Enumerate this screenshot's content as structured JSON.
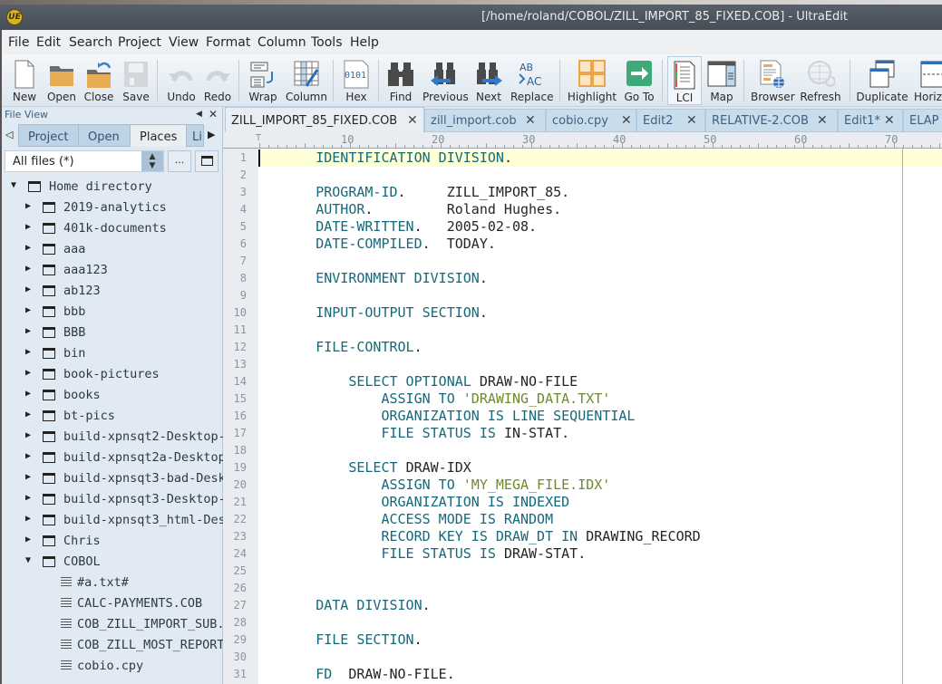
{
  "window": {
    "title": "[/home/roland/COBOL/ZILL_IMPORT_85_FIXED.COB] - UltraEdit",
    "logo": "UE"
  },
  "menu": [
    "File",
    "Edit",
    "Search",
    "Project",
    "View",
    "Format",
    "Column",
    "Tools",
    "Help"
  ],
  "toolbar": [
    {
      "label": "New",
      "icon": "new-file-icon"
    },
    {
      "label": "Open",
      "icon": "open-folder-icon"
    },
    {
      "label": "Close",
      "icon": "close-folder-icon"
    },
    {
      "label": "Save",
      "icon": "save-icon",
      "disabled": true
    },
    {
      "label": "Undo",
      "icon": "undo-icon",
      "disabled": true
    },
    {
      "label": "Redo",
      "icon": "redo-icon",
      "disabled": true
    },
    {
      "label": "Wrap",
      "icon": "wrap-icon"
    },
    {
      "label": "Column",
      "icon": "column-mode-icon"
    },
    {
      "label": "Hex",
      "icon": "hex-icon"
    },
    {
      "label": "Find",
      "icon": "binoculars-icon"
    },
    {
      "label": "Previous",
      "icon": "find-previous-icon"
    },
    {
      "label": "Next",
      "icon": "find-next-icon"
    },
    {
      "label": "Replace",
      "icon": "replace-icon"
    },
    {
      "label": "Highlight",
      "icon": "highlight-icon"
    },
    {
      "label": "Go To",
      "icon": "goto-icon"
    },
    {
      "label": "LCI",
      "icon": "lci-icon",
      "active": true
    },
    {
      "label": "Map",
      "icon": "map-icon"
    },
    {
      "label": "Browser",
      "icon": "browser-icon"
    },
    {
      "label": "Refresh",
      "icon": "refresh-icon",
      "disabled": true
    },
    {
      "label": "Duplicate",
      "icon": "duplicate-window-icon"
    },
    {
      "label": "Horizontal",
      "icon": "horizontal-split-icon"
    }
  ],
  "file_view": {
    "header": "File View",
    "tabs": [
      "Project",
      "Open",
      "Places",
      "Li"
    ],
    "selected_tab": "Places",
    "filter": "All files (*)",
    "browse_label": "...",
    "tree": [
      {
        "name": "Home directory",
        "type": "folder",
        "depth": 0,
        "expanded": true
      },
      {
        "name": "2019-analytics",
        "type": "folder",
        "depth": 1
      },
      {
        "name": "401k-documents",
        "type": "folder",
        "depth": 1
      },
      {
        "name": "aaa",
        "type": "folder",
        "depth": 1
      },
      {
        "name": "aaa123",
        "type": "folder",
        "depth": 1
      },
      {
        "name": "ab123",
        "type": "folder",
        "depth": 1
      },
      {
        "name": "bbb",
        "type": "folder",
        "depth": 1
      },
      {
        "name": "BBB",
        "type": "folder",
        "depth": 1
      },
      {
        "name": "bin",
        "type": "folder",
        "depth": 1
      },
      {
        "name": "book-pictures",
        "type": "folder",
        "depth": 1
      },
      {
        "name": "books",
        "type": "folder",
        "depth": 1
      },
      {
        "name": "bt-pics",
        "type": "folder",
        "depth": 1
      },
      {
        "name": "build-xpnsqt2-Desktop-",
        "type": "folder",
        "depth": 1
      },
      {
        "name": "build-xpnsqt2a-Desktop",
        "type": "folder",
        "depth": 1
      },
      {
        "name": "build-xpnsqt3-bad-Desk",
        "type": "folder",
        "depth": 1
      },
      {
        "name": "build-xpnsqt3-Desktop-",
        "type": "folder",
        "depth": 1
      },
      {
        "name": "build-xpnsqt3_html-Des",
        "type": "folder",
        "depth": 1
      },
      {
        "name": "Chris",
        "type": "folder",
        "depth": 1
      },
      {
        "name": "COBOL",
        "type": "folder",
        "depth": 1,
        "expanded": true
      },
      {
        "name": "#a.txt#",
        "type": "file",
        "depth": 2
      },
      {
        "name": "CALC-PAYMENTS.COB",
        "type": "file",
        "depth": 2
      },
      {
        "name": "COB_ZILL_IMPORT_SUB.",
        "type": "file",
        "depth": 2
      },
      {
        "name": "COB_ZILL_MOST_REPORT",
        "type": "file",
        "depth": 2
      },
      {
        "name": "cobio.cpy",
        "type": "file",
        "depth": 2
      }
    ]
  },
  "editor": {
    "tabs": [
      {
        "label": "ZILL_IMPORT_85_FIXED.COB",
        "selected": true
      },
      {
        "label": "zill_import.cob"
      },
      {
        "label": "cobio.cpy"
      },
      {
        "label": "Edit2"
      },
      {
        "label": "RELATIVE-2.COB"
      },
      {
        "label": "Edit1*"
      },
      {
        "label": "ELAP"
      }
    ],
    "ruler": [
      "10",
      "20",
      "30",
      "40",
      "50",
      "60",
      "70"
    ],
    "current_line": 1,
    "lines": [
      [
        [
          "kw",
          "       IDENTIFICATION DIVISION"
        ],
        [
          "id",
          "."
        ]
      ],
      [],
      [
        [
          "kw",
          "       PROGRAM-ID"
        ],
        [
          "id",
          ".     ZILL_IMPORT_85."
        ]
      ],
      [
        [
          "kw",
          "       AUTHOR"
        ],
        [
          "id",
          ".         Roland Hughes."
        ]
      ],
      [
        [
          "kw",
          "       DATE-WRITTEN"
        ],
        [
          "id",
          ".   2005-02-08."
        ]
      ],
      [
        [
          "kw",
          "       DATE-COMPILED"
        ],
        [
          "id",
          ".  TODAY."
        ]
      ],
      [],
      [
        [
          "kw",
          "       ENVIRONMENT DIVISION"
        ],
        [
          "id",
          "."
        ]
      ],
      [],
      [
        [
          "kw",
          "       INPUT-OUTPUT SECTION"
        ],
        [
          "id",
          "."
        ]
      ],
      [],
      [
        [
          "kw",
          "       FILE-CONTROL"
        ],
        [
          "id",
          "."
        ]
      ],
      [],
      [
        [
          "kw",
          "           SELECT OPTIONAL "
        ],
        [
          "id",
          "DRAW-NO-FILE"
        ]
      ],
      [
        [
          "kw",
          "               ASSIGN TO "
        ],
        [
          "str",
          "'DRAWING_DATA.TXT'"
        ]
      ],
      [
        [
          "kw",
          "               ORGANIZATION IS LINE SEQUENTIAL"
        ]
      ],
      [
        [
          "kw",
          "               FILE STATUS IS "
        ],
        [
          "id",
          "IN-STAT."
        ]
      ],
      [],
      [
        [
          "kw",
          "           SELECT "
        ],
        [
          "id",
          "DRAW-IDX"
        ]
      ],
      [
        [
          "kw",
          "               ASSIGN TO "
        ],
        [
          "str",
          "'MY_MEGA_FILE.IDX'"
        ]
      ],
      [
        [
          "kw",
          "               ORGANIZATION IS INDEXED"
        ]
      ],
      [
        [
          "kw",
          "               ACCESS MODE IS RANDOM"
        ]
      ],
      [
        [
          "kw",
          "               RECORD KEY IS DRAW_DT IN "
        ],
        [
          "id",
          "DRAWING_RECORD"
        ]
      ],
      [
        [
          "kw",
          "               FILE STATUS IS "
        ],
        [
          "id",
          "DRAW-STAT."
        ]
      ],
      [],
      [],
      [
        [
          "kw",
          "       DATA DIVISION"
        ],
        [
          "id",
          "."
        ]
      ],
      [],
      [
        [
          "kw",
          "       FILE SECTION"
        ],
        [
          "id",
          "."
        ]
      ],
      [],
      [
        [
          "kw",
          "       FD  "
        ],
        [
          "id",
          "DRAW-NO-FILE."
        ]
      ]
    ]
  },
  "colors": {
    "keyword": "#16697a",
    "string": "#6f8a2c",
    "identifier": "#232627",
    "current_line": "#ffffd6",
    "title_bar": "#4c555e"
  }
}
